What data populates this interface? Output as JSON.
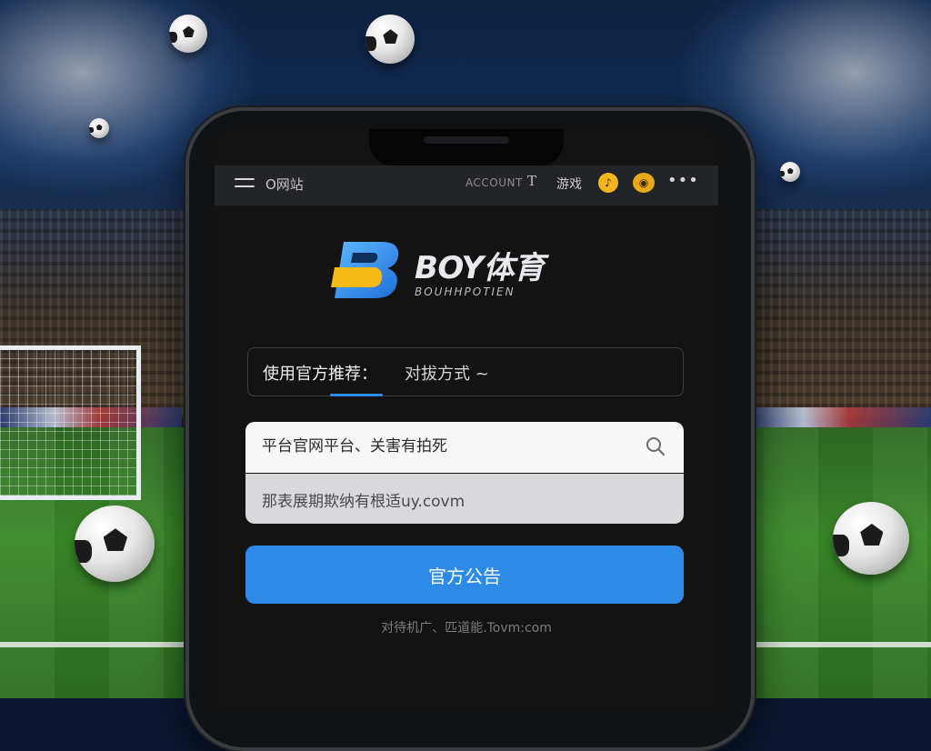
{
  "status_bar": {
    "title": "O网站",
    "account": "ACCOUNT",
    "t_label": "T",
    "game_label": "游戏",
    "coin_icon": "coin-icon",
    "ticket_icon": "ticket-icon",
    "more": "•••"
  },
  "brand": {
    "name": "BOY体育",
    "subtitle": "BOUHHPOTIEN",
    "logo_colors": [
      "#2f8de6",
      "#f5b918"
    ]
  },
  "recommend": {
    "label": "使用官方推荐：",
    "value": "对拔方式 ~"
  },
  "search": {
    "placeholder": "平台官网平台、关害有拍死",
    "domain_hint": "那表展期欺纳有根适uy.covm"
  },
  "notice_button": {
    "label": "官方公告"
  },
  "footer": {
    "url": "对待机广、匹道能.Tovm:com"
  },
  "colors": {
    "accent": "#2d8be6",
    "screen_bg": "#131314",
    "status_bar_bg": "#232427"
  }
}
